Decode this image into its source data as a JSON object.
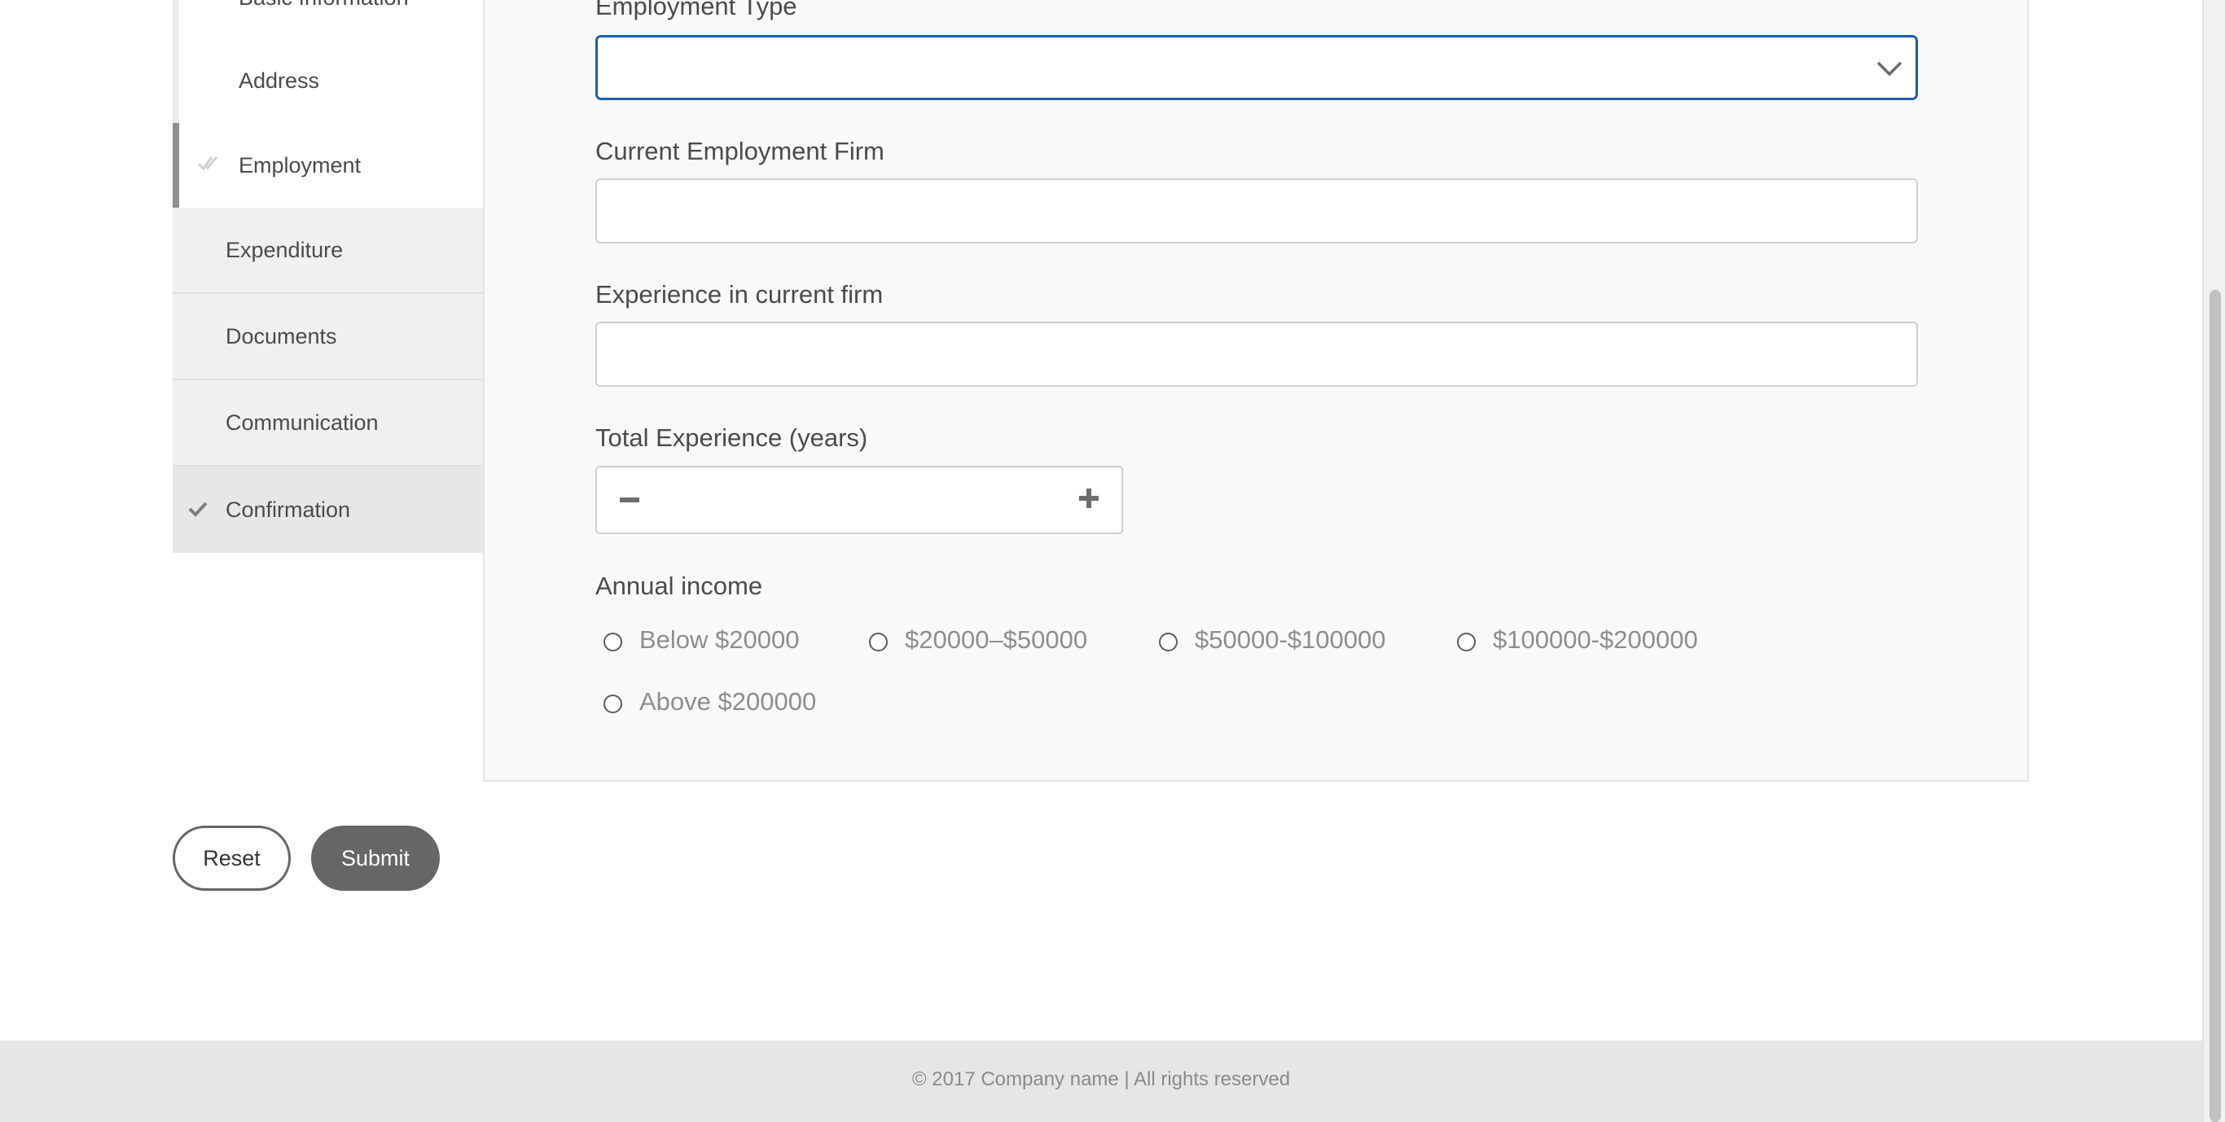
{
  "sidebar": {
    "items": [
      {
        "label": "Basic Information",
        "state": "visited"
      },
      {
        "label": "Address",
        "state": "visited"
      },
      {
        "label": "Employment",
        "state": "active"
      },
      {
        "label": "Expenditure",
        "state": "pending"
      },
      {
        "label": "Documents",
        "state": "pending"
      },
      {
        "label": "Communication",
        "state": "pending"
      },
      {
        "label": "Confirmation",
        "state": "completed"
      }
    ]
  },
  "form": {
    "employment_type": {
      "label": "Employment Type",
      "value": ""
    },
    "current_firm": {
      "label": "Current Employment Firm",
      "value": "",
      "placeholder": ""
    },
    "experience_current": {
      "label": "Experience in current firm",
      "value": "",
      "placeholder": ""
    },
    "total_experience": {
      "label": "Total Experience (years)",
      "value": ""
    },
    "annual_income": {
      "label": "Annual income",
      "options": [
        "Below $20000",
        "$20000–$50000",
        "$50000-$100000",
        "$100000-$200000",
        "Above $200000"
      ],
      "selected": null
    }
  },
  "actions": {
    "reset_label": "Reset",
    "submit_label": "Submit"
  },
  "footer": {
    "text": "© 2017 Company name | All rights reserved"
  },
  "colors": {
    "focus_border": "#1f5fa8",
    "submit_bg": "#666666",
    "panel_bg": "#f9f9f9",
    "footer_bg": "#e6e6e6"
  }
}
